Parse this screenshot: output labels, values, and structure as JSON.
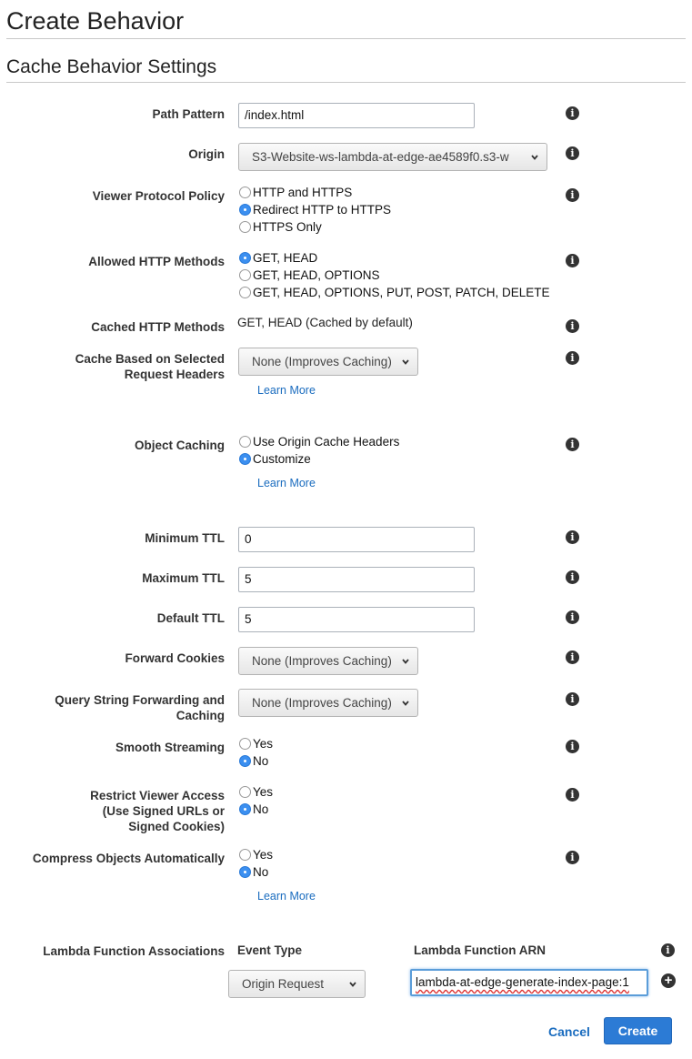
{
  "page": {
    "title": "Create Behavior",
    "section_title": "Cache Behavior Settings"
  },
  "fields": {
    "path_pattern": {
      "label": "Path Pattern",
      "value": "/index.html"
    },
    "origin": {
      "label": "Origin",
      "value": "S3-Website-ws-lambda-at-edge-ae4589f0.s3-w"
    },
    "viewer_protocol": {
      "label": "Viewer Protocol Policy",
      "options": [
        "HTTP and HTTPS",
        "Redirect HTTP to HTTPS",
        "HTTPS Only"
      ],
      "selected": "Redirect HTTP to HTTPS"
    },
    "allowed_methods": {
      "label": "Allowed HTTP Methods",
      "options": [
        "GET, HEAD",
        "GET, HEAD, OPTIONS",
        "GET, HEAD, OPTIONS, PUT, POST, PATCH, DELETE"
      ],
      "selected": "GET, HEAD"
    },
    "cached_methods": {
      "label": "Cached HTTP Methods",
      "value": "GET, HEAD (Cached by default)"
    },
    "cache_headers": {
      "label_line1": "Cache Based on Selected",
      "label_line2": "Request Headers",
      "value": "None (Improves Caching)",
      "link": "Learn More"
    },
    "object_caching": {
      "label": "Object Caching",
      "options": [
        "Use Origin Cache Headers",
        "Customize"
      ],
      "selected": "Customize",
      "link": "Learn More"
    },
    "min_ttl": {
      "label": "Minimum TTL",
      "value": "0"
    },
    "max_ttl": {
      "label": "Maximum TTL",
      "value": "5"
    },
    "default_ttl": {
      "label": "Default TTL",
      "value": "5"
    },
    "forward_cookies": {
      "label": "Forward Cookies",
      "value": "None (Improves Caching)"
    },
    "query_string": {
      "label_line1": "Query String Forwarding and",
      "label_line2": "Caching",
      "value": "None (Improves Caching)"
    },
    "smooth_streaming": {
      "label": "Smooth Streaming",
      "options": [
        "Yes",
        "No"
      ],
      "selected": "No"
    },
    "restrict_viewer": {
      "label_line1": "Restrict Viewer Access",
      "label_line2": "(Use Signed URLs or",
      "label_line3": "Signed Cookies)",
      "options": [
        "Yes",
        "No"
      ],
      "selected": "No"
    },
    "compress": {
      "label": "Compress Objects Automatically",
      "options": [
        "Yes",
        "No"
      ],
      "selected": "No",
      "link": "Learn More"
    }
  },
  "lambda": {
    "label": "Lambda Function Associations",
    "event_type_header": "Event Type",
    "arn_header": "Lambda Function ARN",
    "event_type_value": "Origin Request",
    "arn_value": "lambda-at-edge-generate-index-page:1"
  },
  "actions": {
    "cancel": "Cancel",
    "create": "Create"
  },
  "icons": {
    "info": "info-icon",
    "chevron": "chevron-down-icon",
    "add": "plus-circle-icon"
  },
  "colors": {
    "accent": "#2c7bd5",
    "link": "#1a6cbf"
  }
}
